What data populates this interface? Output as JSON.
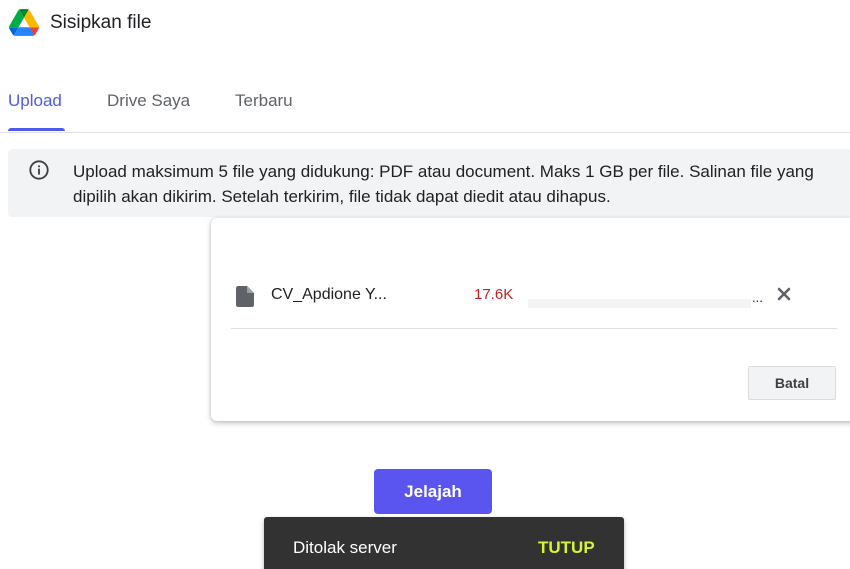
{
  "header": {
    "title": "Sisipkan file",
    "logo_icon": "google-drive-icon"
  },
  "tabs": [
    {
      "label": "Upload",
      "active": true
    },
    {
      "label": "Drive Saya",
      "active": false
    },
    {
      "label": "Terbaru",
      "active": false
    }
  ],
  "info": {
    "icon": "info-icon",
    "text": "Upload maksimum 5 file yang didukung: PDF atau document. Maks 1 GB per file. Salinan file yang\ndipilih akan dikirim. Setelah terkirim, file tidak dapat diedit atau dihapus."
  },
  "upload": {
    "file": {
      "icon": "file-icon",
      "name": "CV_Apdione Y...",
      "size": "17.6K",
      "progress_ellipsis": "...",
      "progress": 0,
      "remove_icon": "close-icon"
    },
    "cancel_label": "Batal"
  },
  "browse_label": "Jelajah",
  "snackbar": {
    "message": "Ditolak server",
    "action": "TUTUP"
  },
  "colors": {
    "accent": "#4d5be8",
    "button": "#5b55f0",
    "error": "#c5221f",
    "snackbar_bg": "#323232",
    "snackbar_action": "#d4f537"
  }
}
